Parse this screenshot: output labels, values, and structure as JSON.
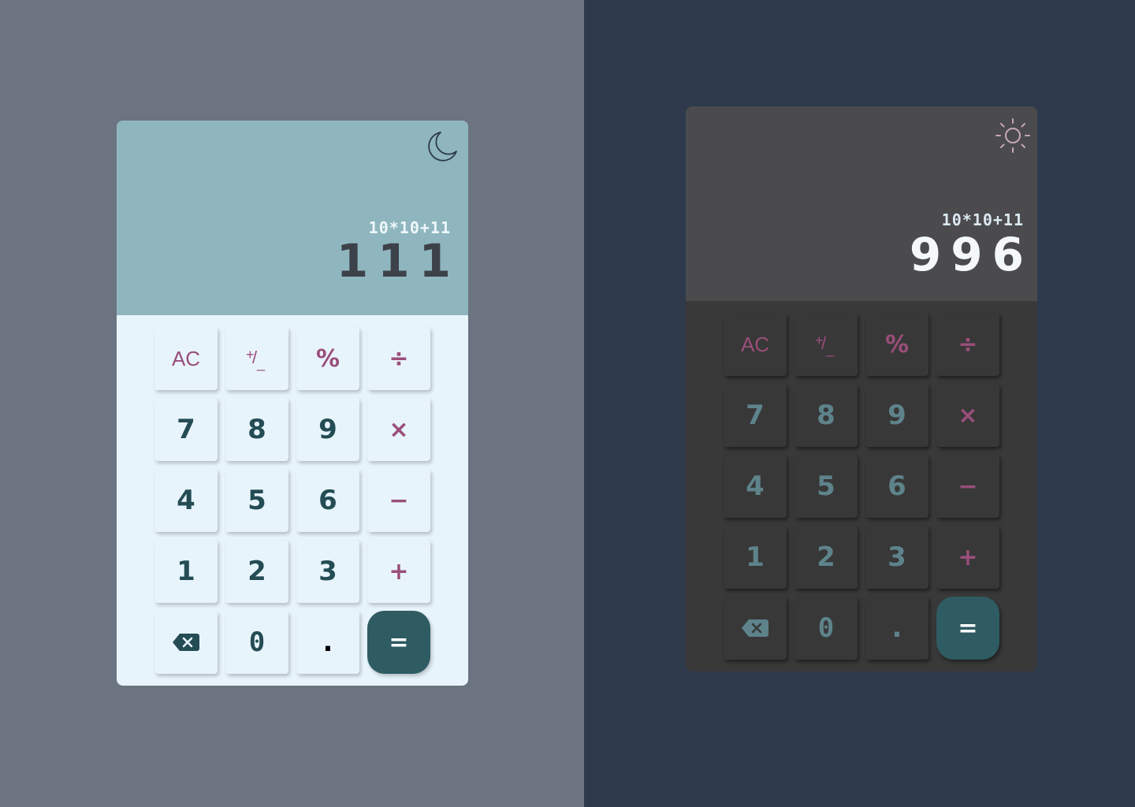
{
  "light": {
    "theme_icon": "moon-icon",
    "expression": "10*10+11",
    "result": "111",
    "keys": {
      "clear": "AC",
      "sign_plus": "+",
      "sign_slash": "/",
      "sign_minus": "_",
      "percent": "%",
      "divide": "÷",
      "seven": "7",
      "eight": "8",
      "nine": "9",
      "multiply": "×",
      "four": "4",
      "five": "5",
      "six": "6",
      "subtract": "−",
      "one": "1",
      "two": "2",
      "three": "3",
      "add": "+",
      "backspace_icon": "backspace-icon",
      "zero": "0",
      "dot": ".",
      "equals": "="
    }
  },
  "dark": {
    "theme_icon": "sun-icon",
    "expression": "10*10+11",
    "result": "996",
    "keys": {
      "clear": "AC",
      "sign_plus": "+",
      "sign_slash": "/",
      "sign_minus": "_",
      "percent": "%",
      "divide": "÷",
      "seven": "7",
      "eight": "8",
      "nine": "9",
      "multiply": "×",
      "four": "4",
      "five": "5",
      "six": "6",
      "subtract": "−",
      "one": "1",
      "two": "2",
      "three": "3",
      "add": "+",
      "backspace_icon": "backspace-icon",
      "zero": "0",
      "dot": ".",
      "equals": "="
    }
  },
  "colors": {
    "left_background": "#6b7480",
    "right_background": "#2e3a4c",
    "light_display": "#8fb6be",
    "dark_display": "#4b4b4d",
    "operator_accent": "#9a4e7a",
    "equals_button": "#2f5b62"
  }
}
